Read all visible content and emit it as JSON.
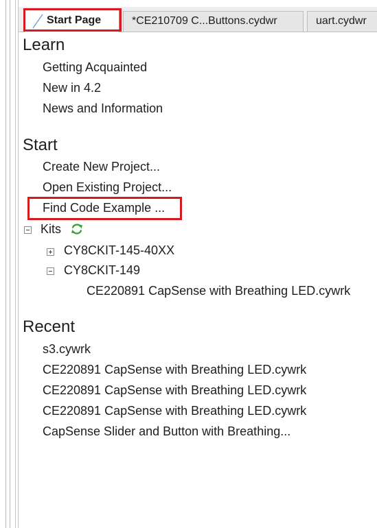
{
  "tabs": [
    {
      "label": "Start Page",
      "active": true
    },
    {
      "label": "*CE210709 C...Buttons.cydwr",
      "active": false
    },
    {
      "label": "uart.cydwr",
      "active": false
    }
  ],
  "learn": {
    "title": "Learn",
    "items": [
      "Getting Acquainted",
      "New in 4.2",
      "News and Information"
    ]
  },
  "start": {
    "title": "Start",
    "items": [
      "Create New Project...",
      "Open Existing Project...",
      "Find Code Example ..."
    ],
    "kits": {
      "label": "Kits",
      "children": [
        {
          "label": "CY8CKIT-145-40XX",
          "expanded": false
        },
        {
          "label": "CY8CKIT-149",
          "expanded": true,
          "children": [
            "CE220891 CapSense with Breathing LED.cywrk"
          ]
        }
      ]
    }
  },
  "recent": {
    "title": "Recent",
    "items": [
      "s3.cywrk",
      "CE220891 CapSense with Breathing LED.cywrk",
      "CE220891 CapSense with Breathing LED.cywrk",
      "CE220891 CapSense with Breathing LED.cywrk",
      "CapSense Slider and Button with Breathing..."
    ]
  },
  "colors": {
    "highlight": "#d71920",
    "refresh": "#3aa13a"
  }
}
